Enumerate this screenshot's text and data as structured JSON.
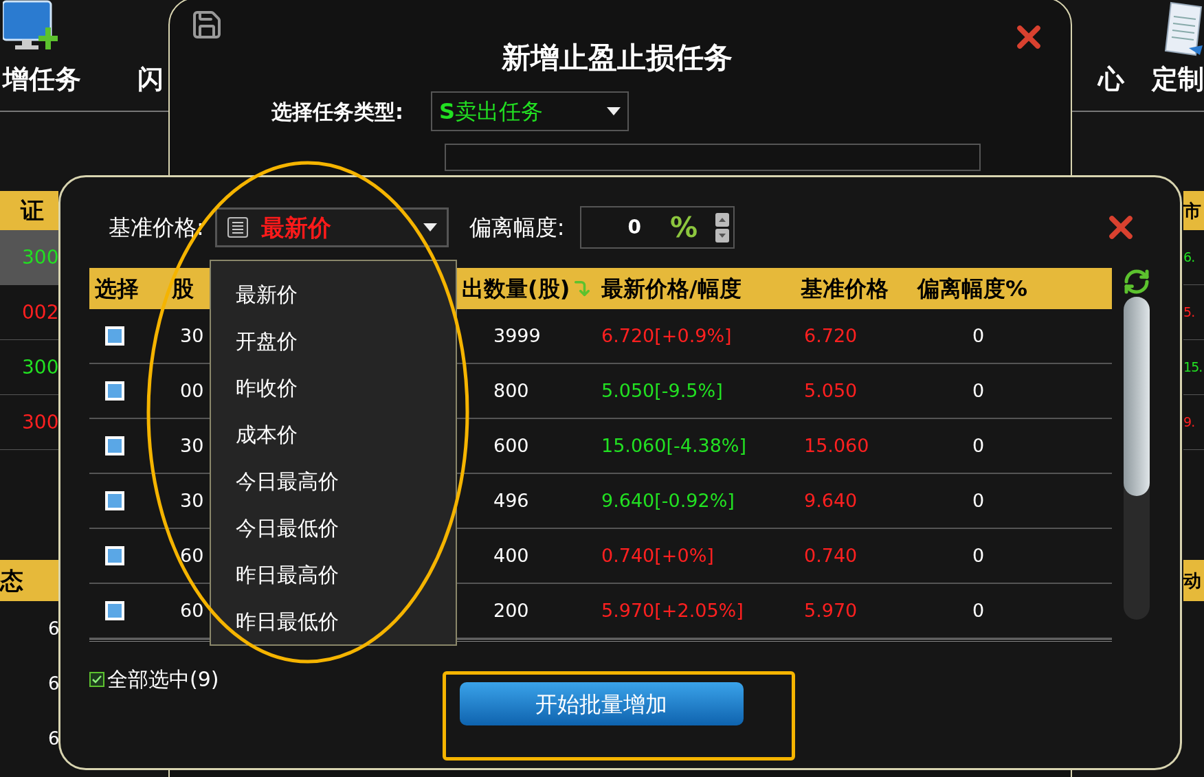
{
  "background_app": {
    "toolbar": [
      {
        "label": "增任务"
      },
      {
        "label": "闪"
      },
      {
        "label": "心"
      },
      {
        "label": "定制"
      }
    ],
    "left_table": {
      "header": "证",
      "rows": [
        {
          "code": "300",
          "color": "#22e022",
          "selected": true
        },
        {
          "code": "002",
          "color": "#ff2020",
          "selected": false
        },
        {
          "code": "300",
          "color": "#22e022",
          "selected": false
        },
        {
          "code": "300",
          "color": "#ff2020",
          "selected": false
        }
      ],
      "header_2": "态",
      "rows_2": [
        "6",
        "6",
        "6"
      ]
    },
    "right_table": {
      "header": "市",
      "rows": [
        {
          "value": "6.",
          "color": "#22e022"
        },
        {
          "value": "5.",
          "color": "#ff2020"
        },
        {
          "value": "15.",
          "color": "#22e022"
        },
        {
          "value": "9.",
          "color": "#ff2020"
        }
      ],
      "header_2": "动"
    }
  },
  "task_dialog": {
    "title": "新增止盈止损任务",
    "type_label": "选择任务类型:",
    "type_value": "**S**卖出任务"
  },
  "batch_dialog": {
    "base_price_label": "基准价格:",
    "base_price_value": "最新价",
    "deviation_label": "偏离幅度:",
    "deviation_value": "0",
    "deviation_unit": "%",
    "table": {
      "columns": [
        "选择",
        "股",
        "出数量(股)",
        "最新价格/幅度",
        "基准价格",
        "偏离幅度%"
      ],
      "rows": [
        {
          "checked": true,
          "code": "30",
          "quantity": "3999",
          "price": "6.720[+0.9%]",
          "color": "#ff2020",
          "base_price": "6.720",
          "deviation": "0"
        },
        {
          "checked": true,
          "code": "00",
          "quantity": "800",
          "price": "5.050[-9.5%]",
          "color": "#22e022",
          "base_price": "5.050",
          "deviation": "0"
        },
        {
          "checked": true,
          "code": "30",
          "quantity": "600",
          "price": "15.060[-4.38%]",
          "color": "#22e022",
          "base_price": "15.060",
          "deviation": "0"
        },
        {
          "checked": true,
          "code": "30",
          "quantity": "496",
          "price": "9.640[-0.92%]",
          "color": "#22e022",
          "base_price": "9.640",
          "deviation": "0"
        },
        {
          "checked": true,
          "code": "60",
          "quantity": "400",
          "price": "0.740[+0%]",
          "color": "#ff2020",
          "base_price": "0.740",
          "deviation": "0"
        },
        {
          "checked": true,
          "code": "60",
          "quantity": "200",
          "price": "5.970[+2.05%]",
          "color": "#ff2020",
          "base_price": "5.970",
          "deviation": "0"
        }
      ]
    },
    "select_all": {
      "label": "全部选中(9)",
      "checked": true
    },
    "submit_button": "开始批量增加",
    "base_price_dropdown": {
      "options": [
        "最新价",
        "开盘价",
        "昨收价",
        "成本价",
        "今日最高价",
        "今日最低价",
        "昨日最高价",
        "昨日最低价"
      ]
    }
  }
}
